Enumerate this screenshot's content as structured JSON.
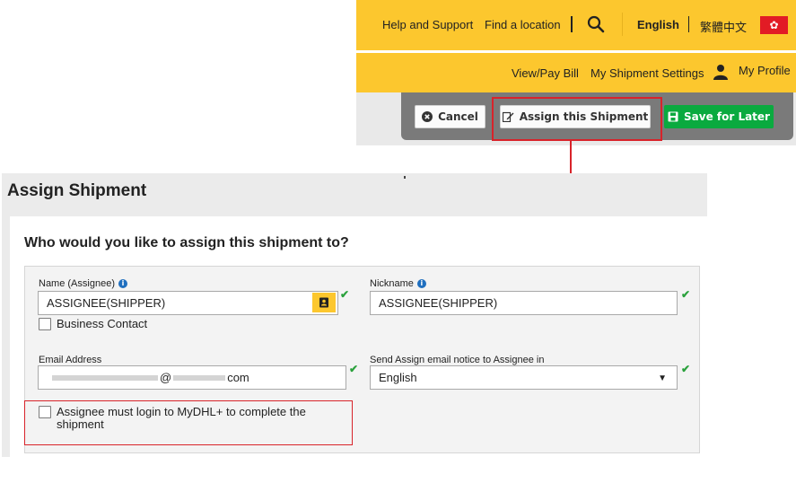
{
  "topnav": {
    "help_label": "Help and Support",
    "find_label": "Find a location",
    "language_label": "English",
    "alt_language_label": "繁體中文",
    "flag_icon": "hong-kong-flag-icon",
    "search_icon": "search-icon"
  },
  "subnav": {
    "view_pay_bill": "View/Pay Bill",
    "shipment_settings": "My Shipment Settings",
    "profile_label": "My Profile"
  },
  "actions": {
    "cancel_label": "Cancel",
    "assign_label": "Assign this Shipment",
    "save_label": "Save for Later"
  },
  "panel": {
    "title": "Assign Shipment",
    "question": "Who would you like to assign this shipment to?"
  },
  "form": {
    "name_label": "Name (Assignee)",
    "name_value": "ASSIGNEE(SHIPPER)",
    "business_contact_label": "Business Contact",
    "nickname_label": "Nickname",
    "nickname_value": "ASSIGNEE(SHIPPER)",
    "email_label": "Email Address",
    "email_at": "@",
    "email_suffix": "com",
    "notice_label": "Send Assign email notice to Assignee in",
    "notice_value": "English",
    "login_required_label": "Assignee must login to MyDHL+ to complete the shipment"
  },
  "colors": {
    "dhl_yellow": "#fcc72e",
    "highlight_red": "#d8232a",
    "save_green": "#0aaa3f",
    "valid_green": "#2aa13c"
  }
}
